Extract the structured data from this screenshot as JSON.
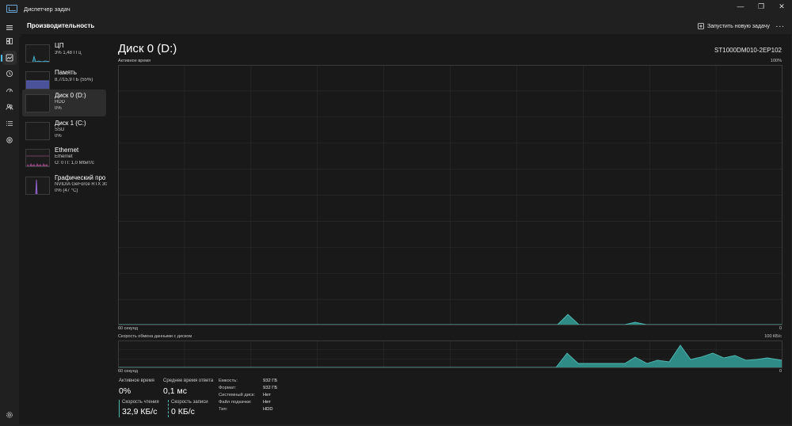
{
  "window": {
    "title": "Диспетчер задач",
    "controls": [
      "—",
      "❐",
      "✕"
    ]
  },
  "header": {
    "title": "Производительность",
    "run_task_label": "Запустить новую задачу",
    "more_label": "···"
  },
  "devices": [
    {
      "name": "ЦП",
      "sub1": "3%  1,48 ГГц",
      "sub2": ""
    },
    {
      "name": "Память",
      "sub1": "8,7/15,9 ГБ (55%)",
      "sub2": ""
    },
    {
      "name": "Диск 0 (D:)",
      "sub1": "HDD",
      "sub2": "0%"
    },
    {
      "name": "Диск 1 (C:)",
      "sub1": "SSD",
      "sub2": "0%"
    },
    {
      "name": "Ethernet",
      "sub1": "Ethernet",
      "sub2": "О: 0 П: 1,0 Мбит/с"
    },
    {
      "name": "Графический про",
      "sub1": "NVIDIA GeForce RTX 306",
      "sub2": "0%  (47 °C)"
    }
  ],
  "main": {
    "disk_title": "Диск 0 (D:)",
    "disk_model": "ST1000DM010-2EP102",
    "active_time_label": "Активное время",
    "active_max": "100%",
    "active_xlabel": "60 секунд",
    "active_min": "0",
    "transfer_label": "Скорость обмена данными с диском",
    "transfer_max": "100 КБ/с",
    "transfer_xlabel": "60 секунд",
    "transfer_min": "0"
  },
  "stats": {
    "active_time_label": "Активное время",
    "active_time_value": "0%",
    "avg_response_label": "Среднее время ответа",
    "avg_response_value": "0,1 мс",
    "read_speed_label": "Скорость чтения",
    "read_speed_value": "32,9 КБ/с",
    "write_speed_label": "Скорость записи",
    "write_speed_value": "0 КБ/с"
  },
  "info": [
    {
      "key": "Емкость:",
      "value": "932 ГБ"
    },
    {
      "key": "Формат:",
      "value": "932 ГБ"
    },
    {
      "key": "Системный диск:",
      "value": "Нет"
    },
    {
      "key": "Файл подкачки:",
      "value": "Нет"
    },
    {
      "key": "Тип:",
      "value": "HDD"
    }
  ],
  "colors": {
    "accent": "#4cc2ff",
    "disk_line": "#4fb9b3",
    "disk_fill": "#2f8b86",
    "cpu": "#4fb9d9",
    "memory": "#6673cc",
    "ethernet": "#c766a8",
    "gpu": "#a06be0"
  },
  "icons": {
    "rail": [
      "hamburger-icon",
      "processes-icon",
      "performance-icon",
      "history-icon",
      "startup-icon",
      "users-icon",
      "details-icon",
      "services-icon",
      "settings-icon"
    ],
    "run_task": "run-task-icon"
  }
}
